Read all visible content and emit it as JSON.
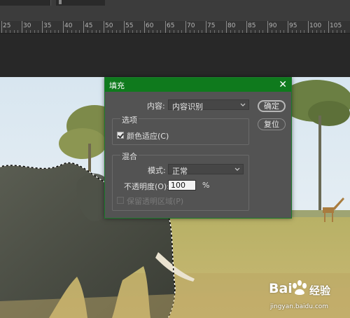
{
  "tab": {
    "doc_label": ""
  },
  "ruler": {
    "labels": [
      "25",
      "30",
      "35",
      "40",
      "45",
      "50",
      "55",
      "60",
      "65",
      "70",
      "75",
      "80",
      "85",
      "90",
      "95",
      "100",
      "105"
    ]
  },
  "dialog": {
    "title": "填充",
    "close_icon": "close-icon",
    "content_label": "内容:",
    "content_value": "内容识别",
    "ok_label": "确定",
    "reset_label": "复位",
    "options_group_title": "选项",
    "color_adapt_label": "颜色适应(C)",
    "color_adapt_checked": true,
    "blend_group_title": "混合",
    "mode_label": "模式:",
    "mode_value": "正常",
    "opacity_label": "不透明度(O):",
    "opacity_value": "100",
    "opacity_unit": "%",
    "preserve_label": "保留透明区域(P)",
    "preserve_enabled": false
  },
  "watermark": {
    "brand_left": "Bai",
    "brand_right": "经验",
    "url": "jingyan.baidu.com"
  },
  "colors": {
    "title_bar": "#0f7a1d",
    "dialog_bg": "#535353",
    "ruler_bg": "#343434"
  }
}
